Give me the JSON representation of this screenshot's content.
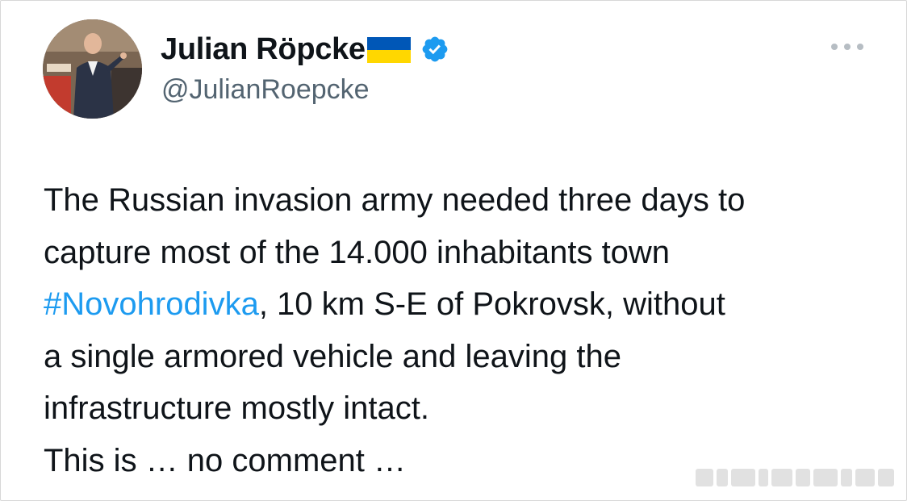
{
  "author": {
    "display_name": "Julian Röpcke",
    "flag_emoji": "ukraine-flag",
    "verified": true,
    "handle": "@JulianRoepcke"
  },
  "tweet": {
    "lines": [
      {
        "text": "The Russian invasion army needed three days to"
      },
      {
        "text": "capture most of the 14.000 inhabitants town"
      },
      {
        "hashtag": "#Novohrodivka",
        "text": ", 10 km S-E of Pokrovsk, without"
      },
      {
        "text": "a single armored vehicle and leaving the"
      },
      {
        "text": "infrastructure mostly intact."
      },
      {
        "text": "This is … no comment …"
      }
    ]
  },
  "colors": {
    "link": "#1d9bf0",
    "verified_badge": "#1d9bf0",
    "handle": "#536471",
    "flag_blue": "#0057b7",
    "flag_yellow": "#ffd700"
  }
}
